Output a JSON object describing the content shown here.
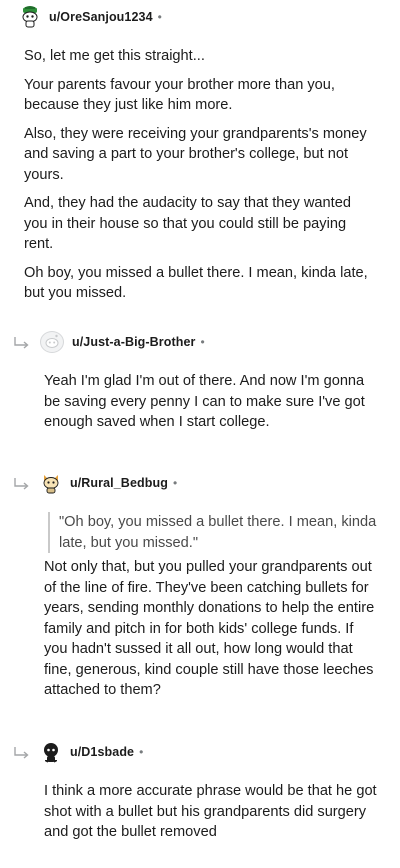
{
  "comments": [
    {
      "username": "u/OreSanjou1234",
      "separator": "•",
      "avatar_icon": "snoo-avatar-green-hat-icon",
      "paragraphs": [
        "So, let me get this straight...",
        "Your parents favour your brother more than you, because they just like him more.",
        "Also, they were receiving your grandparents's money and saving a part to your brother's college, but not yours.",
        "And, they had the audacity to say that they wanted you in their house so that you could still be paying rent.",
        "Oh boy, you missed a bullet there. I mean, kinda late, but you missed."
      ]
    },
    {
      "username": "u/Just-a-Big-Brother",
      "separator": "•",
      "avatar_icon": "snoo-avatar-default-icon",
      "paragraphs": [
        "Yeah I'm glad I'm out of there. And now I'm gonna be saving every penny I can to make sure I've got enough saved when I start college."
      ]
    },
    {
      "username": "u/Rural_Bedbug",
      "separator": "•",
      "avatar_icon": "snoo-avatar-cat-ears-icon",
      "quote": "\"Oh boy, you missed a bullet there. I mean, kinda late, but you missed.\"",
      "paragraphs": [
        "Not only that, but you pulled your grandparents out of the line of fire. They've been catching bullets for years, sending monthly donations to help the entire family and pitch in for both kids' college funds. If you hadn't sussed it all out, how long would that fine, generous, kind couple still have those leeches attached to them?"
      ]
    },
    {
      "username": "u/D1sbade",
      "separator": "•",
      "avatar_icon": "snoo-avatar-dark-icon",
      "paragraphs": [
        "I think a more accurate phrase would be that he got shot with a bullet but his grandparents did surgery and got the bullet removed"
      ]
    }
  ],
  "colors": {
    "text": "#1c1c1c",
    "meta": "#787c7e",
    "quote_bar": "#c9c9c9",
    "reply_arrow": "#a4a6a8"
  }
}
